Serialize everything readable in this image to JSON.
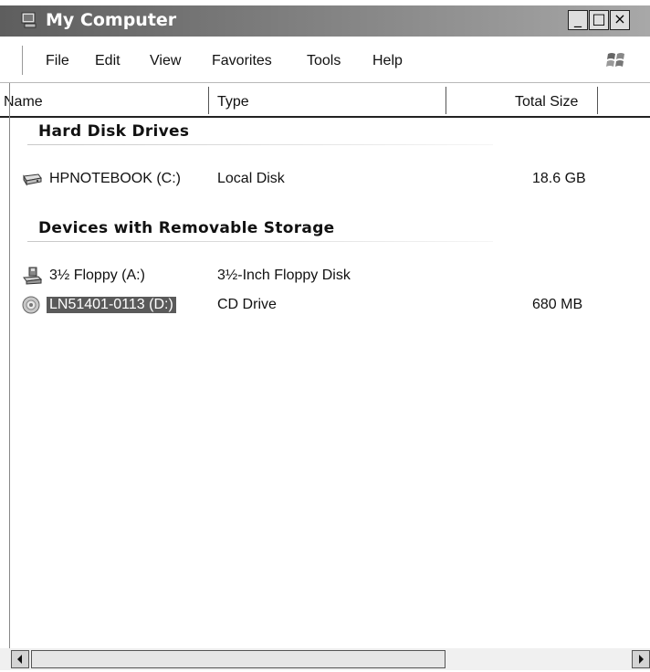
{
  "window": {
    "title": "My Computer"
  },
  "caption_buttons": {
    "minimize": "_",
    "maximize": "□",
    "close": "×"
  },
  "menu": [
    {
      "label": "File"
    },
    {
      "label": "Edit"
    },
    {
      "label": "View"
    },
    {
      "label": "Favorites"
    },
    {
      "label": "Tools"
    },
    {
      "label": "Help"
    }
  ],
  "columns": {
    "name": "Name",
    "type": "Type",
    "total_size": "Total Size"
  },
  "groups": [
    {
      "title": "Hard Disk Drives",
      "items": [
        {
          "name": "HPNOTEBOOK (C:)",
          "type": "Local Disk",
          "size": "18.6 GB",
          "icon": "hard-drive-icon"
        }
      ]
    },
    {
      "title": "Devices with Removable Storage",
      "items": [
        {
          "name": "3½ Floppy (A:)",
          "type": "3½-Inch Floppy Disk",
          "size": "",
          "icon": "floppy-drive-icon"
        },
        {
          "name": "LN51401-0113 (D:)",
          "type": "CD Drive",
          "size": "680 MB",
          "icon": "cd-drive-icon",
          "selected": true
        }
      ]
    }
  ],
  "colors": {
    "titlebar": "#5e5e5e",
    "selection": "#5a5a5a"
  }
}
